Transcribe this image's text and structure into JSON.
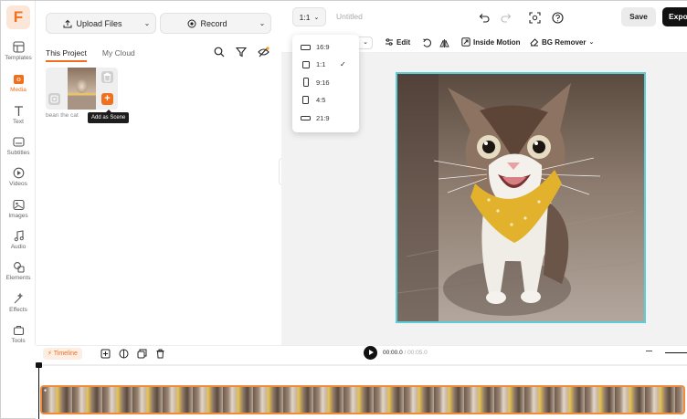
{
  "rail": {
    "items": [
      {
        "label": "Templates",
        "icon": "templates-icon"
      },
      {
        "label": "Media",
        "icon": "media-icon"
      },
      {
        "label": "Text",
        "icon": "text-icon"
      },
      {
        "label": "Subtitles",
        "icon": "subtitles-icon"
      },
      {
        "label": "Videos",
        "icon": "videos-icon"
      },
      {
        "label": "Images",
        "icon": "images-icon"
      },
      {
        "label": "Audio",
        "icon": "audio-icon"
      },
      {
        "label": "Elements",
        "icon": "elements-icon"
      },
      {
        "label": "Effects",
        "icon": "effects-icon"
      },
      {
        "label": "Tools",
        "icon": "tools-icon"
      }
    ],
    "active": "Media",
    "logo": "F"
  },
  "panel": {
    "upload_label": "Upload Files",
    "record_label": "Record",
    "tabs": [
      "This Project",
      "My Cloud"
    ],
    "active_tab": "This Project",
    "media_name": "bean the cat",
    "tooltip": "Add as Scene"
  },
  "topbar": {
    "ratio": "1:1",
    "project_title": "Untitled",
    "save_label": "Save",
    "export_label": "Export"
  },
  "toolbar": {
    "edit_label": "Edit",
    "motion_label": "Inside Motion",
    "bg_label": "BG Remover"
  },
  "ratio_menu": {
    "options": [
      "16:9",
      "1:1",
      "9:16",
      "4:5",
      "21:9"
    ],
    "selected": "1:1"
  },
  "timeline": {
    "button_label": "Timeline",
    "current_time": "00:00.0",
    "total_time": "/ 00:05.0"
  },
  "colors": {
    "accent": "#f0701e",
    "selection": "#5bcdd6",
    "track_border": "#f08a3c"
  }
}
